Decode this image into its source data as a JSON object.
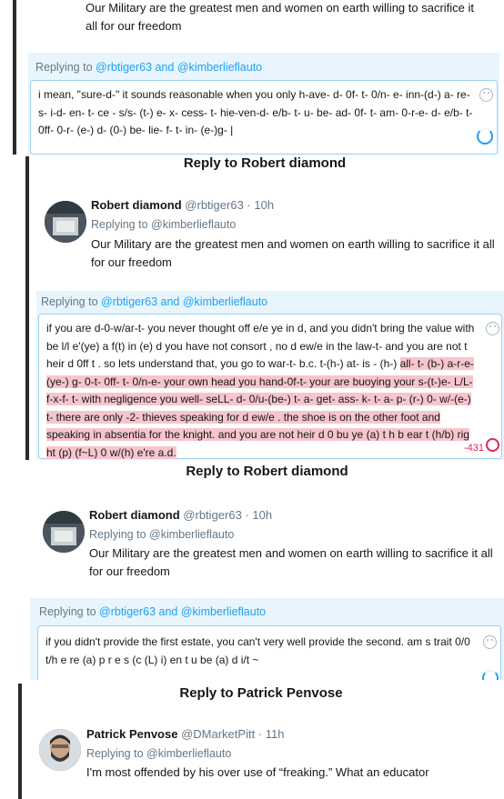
{
  "tweet_text": "Our Military are the greatest men and women on earth willing to sacrifice it all for our freedom",
  "replying_label": "Replying to",
  "reply_handles": "@rbtiger63 and @kimberlieflauto",
  "replying_to_kimberlie": "Replying to @kimberlieflauto",
  "panel1": {
    "reply_text": "i mean, \"sure-d-\"  it sounds reasonable when you only h-ave- d- 0f- t- 0/n- e- inn-(d-) a- re- s- i-d- en- t- ce - s/s- (t-) e- x- cess- t- hie-ven-d-  e/b- t- u- be- ad- 0f- t- am- 0-r-e- d- e/b- t- 0ff- 0-r- (e-) d- (0-) be- lie- f- t- in- (e-)g- |"
  },
  "panel2": {
    "header": "Reply to Robert diamond",
    "author_name": "Robert diamond",
    "author_handle": "@rbtiger63",
    "time": "10h",
    "reply_text_plain": "if you are d-0-w/ar-t- you never thought off e/e ye in d, and you didn't bring the value with be l/l e'(ye) a f(t) in (e) d   you have not consort , no d ew/e  in the law-t- and you are not t heir d 0ff t .   so lets understand that, you go to war-t- b.c. t-(h-) at- is - (h-) ",
    "reply_text_highlight": "all- t- (b-) a-r-e- (ye-) g- 0-t-  0ff- t-  0/n-e- your own head you hand-0f-t-  your are buoying your s-(t-)e- L/L- f-x-f- t- with negligence you well- seLL- d- 0/u-(be-) t- a- get- ass- k- t- a- p- (r-) 0- w/-(e-) t-  there are only -2- thieves speaking for d ew/e .   the shoe is on the other foot and speaking in absentia for the knight.  and you are not heir d 0 bu ye (a) t h b ear t (h/b) rig ht (p) (f~L) 0 w/(h) e're a.d.",
    "char_count": "-431"
  },
  "panel3": {
    "header": "Reply to Robert diamond",
    "author_name": "Robert diamond",
    "author_handle": "@rbtiger63",
    "time": "10h",
    "reply_text": "if you didn't provide the first estate, you can't very well provide the second. am s trait 0/0 t/h e re (a) p r e s (c (L) i) en t u be (a) d i/t ~"
  },
  "panel4": {
    "header": "Reply to Patrick Penvose",
    "author_name": "Patrick Penvose",
    "author_handle": "@DMarketPitt",
    "time": "11h",
    "tweet_text": "I'm most offended by his over use of “freaking.” What an educator"
  }
}
